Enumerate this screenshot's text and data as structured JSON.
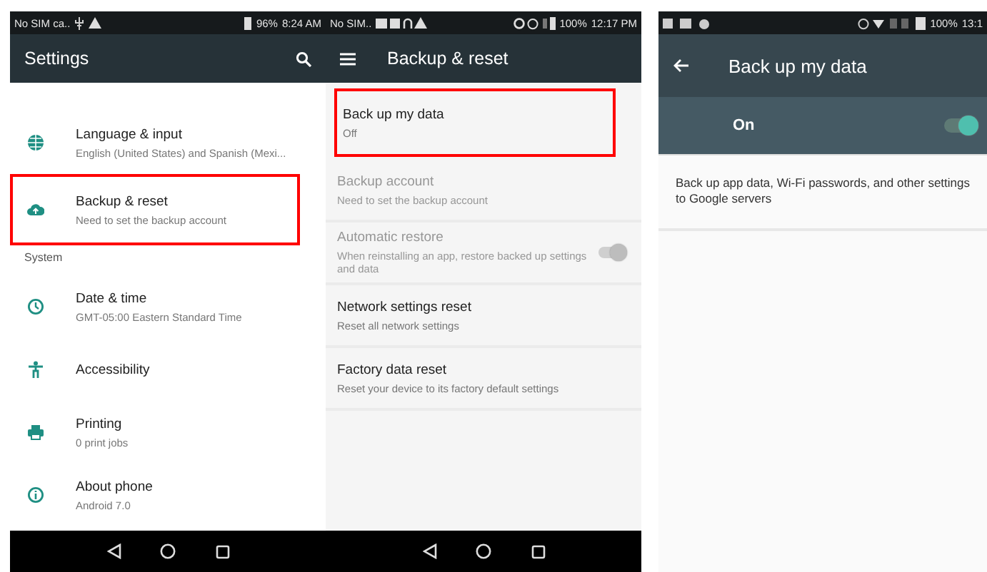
{
  "settings_screen": {
    "status_bar": {
      "carrier": "No SIM ca..",
      "battery": "96%",
      "time": "8:24 AM"
    },
    "title": "Settings",
    "list": [
      {
        "kind": "item",
        "title": "Language & input",
        "subtitle": "English (United States) and Spanish (Mexi...",
        "highlighted": false
      },
      {
        "kind": "item",
        "title": "Backup & reset",
        "subtitle": "Need to set the backup account",
        "highlighted": true
      },
      {
        "kind": "header",
        "title": "System"
      },
      {
        "kind": "item",
        "title": "Date & time",
        "subtitle": "GMT-05:00 Eastern Standard Time",
        "highlighted": false
      },
      {
        "kind": "item",
        "title": "Accessibility",
        "highlighted": false
      },
      {
        "kind": "item",
        "title": "Printing",
        "subtitle": "0 print jobs",
        "highlighted": false
      },
      {
        "kind": "item",
        "title": "About phone",
        "subtitle": "Android 7.0",
        "highlighted": false
      }
    ]
  },
  "backup_screen": {
    "status_bar": {
      "carrier": "No SIM..",
      "battery": "100%",
      "time": "12:17 PM"
    },
    "title": "Backup & reset",
    "list": [
      {
        "title": "Back up my data",
        "subtitle": "Off",
        "highlighted": true,
        "disabled": false
      },
      {
        "title": "Backup account",
        "subtitle": "Need to set the backup account",
        "highlighted": false,
        "disabled": true
      },
      {
        "title": "Automatic restore",
        "subtitle": "When reinstalling an app, restore backed up settings and data",
        "highlighted": false,
        "disabled": true,
        "toggle": {
          "on": true
        }
      },
      {
        "title": "Network settings reset",
        "subtitle": "Reset all network settings",
        "highlighted": false,
        "disabled": false
      },
      {
        "title": "Factory data reset",
        "subtitle": "Reset your device to its factory default settings",
        "highlighted": false,
        "disabled": false
      }
    ]
  },
  "backup_data_screen": {
    "status_bar": {
      "battery": "100%",
      "time": "13:1"
    },
    "title": "Back up my data",
    "switch": {
      "label": "On",
      "on": true
    },
    "description": "Back up app data, Wi-Fi passwords, and other settings to Google servers"
  }
}
